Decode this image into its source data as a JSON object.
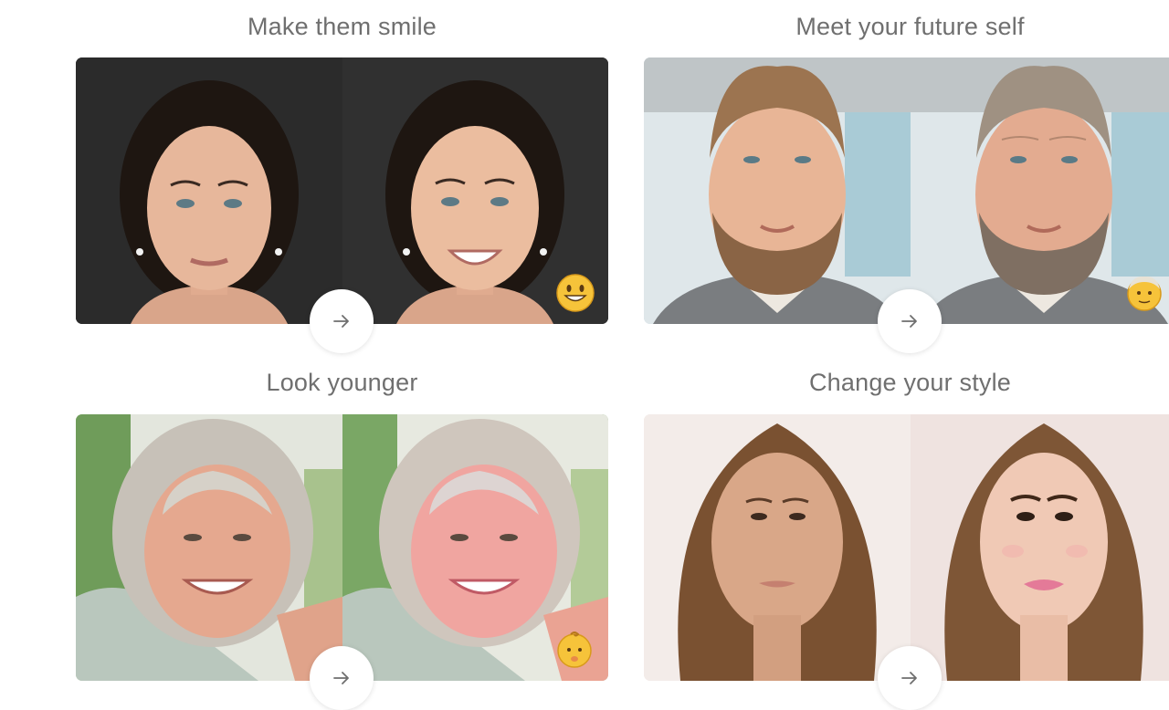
{
  "cards": [
    {
      "title": "Make them smile",
      "filter": "smile",
      "before_photo": "woman-neutral-face",
      "after_photo": "woman-smiling-face",
      "emoji": "smiling-face-emoji",
      "colors": {
        "bg": "#2b2b2b",
        "skin": "#e7b79b",
        "hair": "#1e1611"
      }
    },
    {
      "title": "Meet your future self",
      "filter": "old",
      "before_photo": "bearded-man-face",
      "after_photo": "aged-bearded-man-face",
      "emoji": "older-man-emoji",
      "colors": {
        "bg": "#c9d8df",
        "skin": "#e8b596",
        "hair": "#9c7450"
      }
    },
    {
      "title": "Look younger",
      "filter": "young",
      "before_photo": "older-woman-smiling",
      "after_photo": "younger-woman-smiling",
      "emoji": "baby-emoji",
      "colors": {
        "bg": "#6f9c5a",
        "skin": "#eab29a",
        "hair": "#c7c1b8"
      }
    },
    {
      "title": "Change your style",
      "filter": "makeup",
      "before_photo": "woman-no-makeup",
      "after_photo": "woman-with-makeup",
      "emoji": "",
      "colors": {
        "bg": "#f0e6e2",
        "skin": "#d9a788",
        "hair": "#7a5131"
      }
    }
  ],
  "arrow_icon": "arrow-right-icon",
  "accent": "#6f6f6f"
}
